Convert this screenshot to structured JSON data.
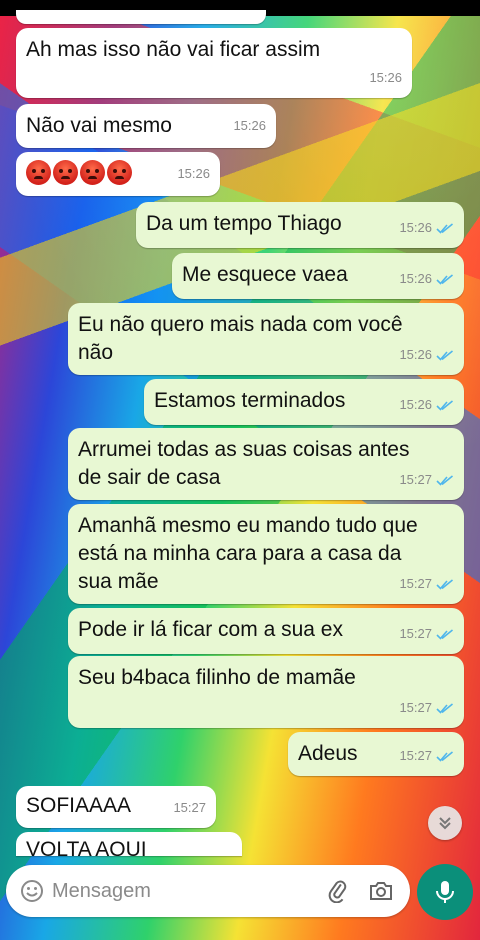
{
  "messages": [
    {
      "text": "Ah mas isso não vai ficar assim",
      "time": "15:26",
      "dir": "in"
    },
    {
      "text": "Não vai mesmo",
      "time": "15:26",
      "dir": "in"
    },
    {
      "emoji": "😡😡😡😡",
      "time": "15:26",
      "dir": "in"
    },
    {
      "text": "Da um tempo Thiago",
      "time": "15:26",
      "dir": "out"
    },
    {
      "text": "Me esquece vaea",
      "time": "15:26",
      "dir": "out"
    },
    {
      "text": "Eu não quero mais nada com você\nnão",
      "time": "15:26",
      "dir": "out"
    },
    {
      "text": "Estamos terminados",
      "time": "15:26",
      "dir": "out"
    },
    {
      "text": "Arrumei todas as suas coisas antes\nde sair de casa",
      "time": "15:27",
      "dir": "out"
    },
    {
      "text": "Amanhã mesmo eu mando tudo que\nestá na minha cara para a casa da\nsua mãe",
      "time": "15:27",
      "dir": "out"
    },
    {
      "text": "Pode ir lá ficar com a sua ex",
      "time": "15:27",
      "dir": "out"
    },
    {
      "text": "Seu b4baca filinho de mamãe",
      "time": "15:27",
      "dir": "out"
    },
    {
      "text": "Adeus",
      "time": "15:27",
      "dir": "out"
    },
    {
      "text": "SOFIAAAA",
      "time": "15:27",
      "dir": "in"
    },
    {
      "text": "VOLTA AQUI",
      "time": "",
      "dir": "in"
    }
  ],
  "composer": {
    "placeholder": "Mensagem"
  },
  "icons": {
    "emoji": "emoji-icon",
    "attach": "paperclip-icon",
    "camera": "camera-icon",
    "mic": "microphone-icon",
    "scroll": "double-chevron-down-icon",
    "read": "double-check-icon"
  },
  "colors": {
    "outgoing": "#e8f8d3",
    "incoming": "#ffffff",
    "read_tick": "#4fb6ec",
    "mic_button": "#0b8f7a"
  }
}
